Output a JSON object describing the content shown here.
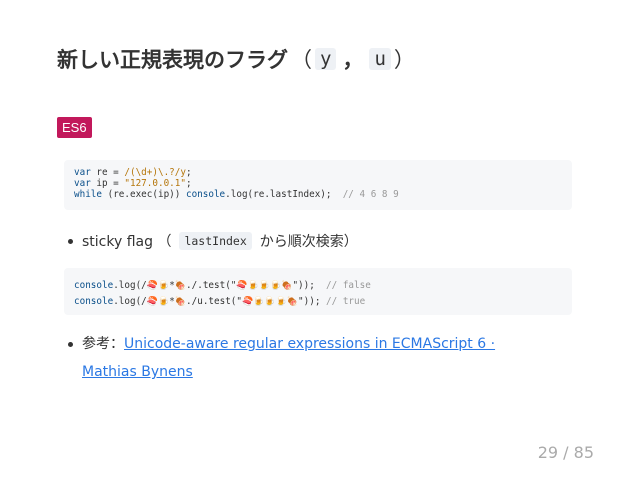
{
  "title": {
    "text": "新しい正規表現のフラグ",
    "open_paren": "（",
    "flag_y": "y",
    "comma": "，",
    "flag_u": "u",
    "close_paren": "）"
  },
  "badge": "ES6",
  "code1": {
    "l1_kw": "var",
    "l1_rest": " re = ",
    "l1_re": "/(\\d+)\\.?/y",
    "l1_end": ";",
    "l2_kw": "var",
    "l2_rest": " ip = ",
    "l2_str": "\"127.0.0.1\"",
    "l2_end": ";",
    "l3_kw": "while",
    "l3_rest": " (re.exec(ip)) ",
    "l3_kw2": "console",
    "l3_rest2": ".log(re.lastIndex);  ",
    "l3_com": "// 4 6 8 9"
  },
  "bullet1": {
    "pre": "sticky flag （",
    "code": "lastIndex",
    "post": "から順次検索）"
  },
  "code2": {
    "l1_kw": "console",
    "l1_a": ".log(/",
    "l1_em1": "🍣🍺",
    "l1_star": "*",
    "l1_em2": "🍖",
    "l1_b": "./.test(\"",
    "l1_em3": "🍣🍺🍺🍺🍖",
    "l1_c": "\"));  ",
    "l1_com": "// false",
    "l2_kw": "console",
    "l2_a": ".log(/",
    "l2_em1": "🍣🍺",
    "l2_star": "*",
    "l2_em2": "🍖",
    "l2_b": "./u.test(\"",
    "l2_em3": "🍣🍺🍺🍺🍖",
    "l2_c": "\")); ",
    "l2_com": "// true"
  },
  "bullet2": {
    "pre": "参考：",
    "link": "Unicode-aware regular expressions in ECMAScript 6 · Mathias Bynens"
  },
  "page_number": "29 / 85"
}
